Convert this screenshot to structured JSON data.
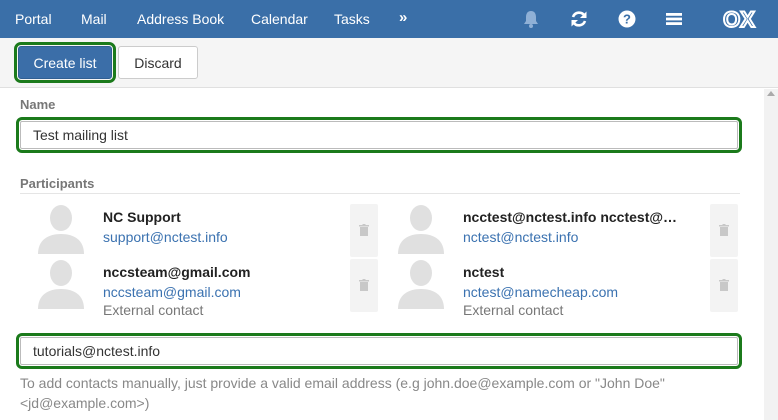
{
  "nav": {
    "items": [
      "Portal",
      "Mail",
      "Address Book",
      "Calendar",
      "Tasks"
    ],
    "more": "»",
    "logo": "OX"
  },
  "icons": {
    "notifications": "bell-icon",
    "refresh": "refresh-icon",
    "help": "help-icon",
    "menu": "hamburger-menu-icon",
    "remove": "trash-icon",
    "avatar": "person-avatar-icon"
  },
  "toolbar": {
    "create_label": "Create list",
    "discard_label": "Discard"
  },
  "form": {
    "name_label": "Name",
    "name_value": "Test mailing list",
    "participants_label": "Participants",
    "add_value": "tutorials@nctest.info",
    "help_text": "To add contacts manually, just provide a valid email address (e.g john.doe@example.com or \"John Doe\" <jd@example.com>)"
  },
  "participants": [
    {
      "name": "NC Support",
      "email": "support@nctest.info",
      "note": ""
    },
    {
      "name": "ncctest@nctest.info ncctest@ncte...",
      "email": "nctest@nctest.info",
      "note": ""
    },
    {
      "name": "nccsteam@gmail.com",
      "email": "nccsteam@gmail.com",
      "note": "External contact"
    },
    {
      "name": "nctest",
      "email": "nctest@namecheap.com",
      "note": "External contact"
    }
  ],
  "colors": {
    "nav_bg": "#3a6fa8",
    "primary_btn": "#3b6ea8",
    "highlight_outline": "#1b7a1b",
    "link": "#3b72b0"
  }
}
